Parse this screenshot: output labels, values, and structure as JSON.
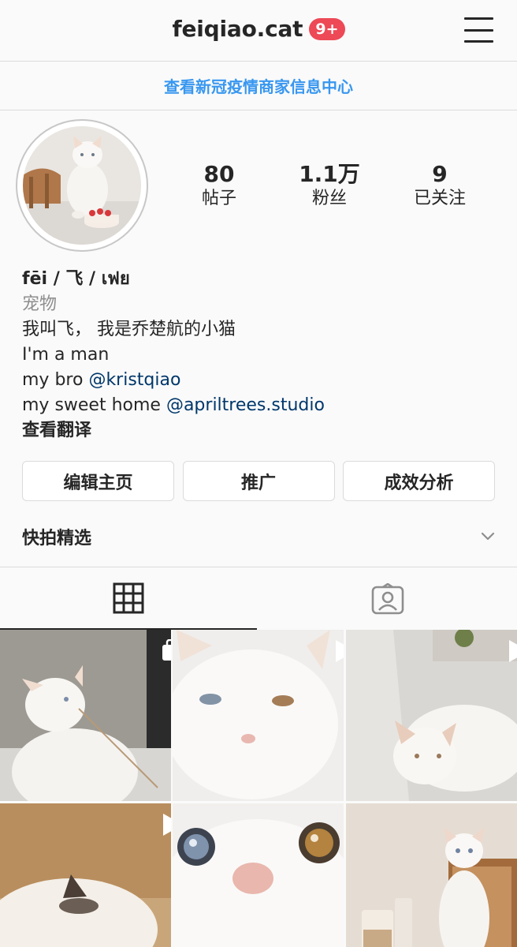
{
  "header": {
    "username": "feiqiao.cat",
    "notification_badge": "9+"
  },
  "banner": {
    "covid_link": "查看新冠疫情商家信息中心"
  },
  "profile": {
    "stats": [
      {
        "value": "80",
        "label": "帖子"
      },
      {
        "value": "1.1万",
        "label": "粉丝"
      },
      {
        "value": "9",
        "label": "已关注"
      }
    ],
    "bio": {
      "name": "fēi / 飞 / เฟย",
      "category": "宠物",
      "line1": "我叫飞， 我是乔楚航的小猫",
      "line2": "I'm a man",
      "line3_prefix": "my bro ",
      "line3_mention": "@kristqiao",
      "line4_prefix": "my sweet home ",
      "line4_mention": "@apriltrees.studio",
      "translate": "查看翻译"
    },
    "buttons": {
      "edit_profile": "编辑主页",
      "promote": "推广",
      "insights": "成效分析"
    },
    "highlights_label": "快拍精选"
  },
  "tabs": {
    "active": "grid",
    "icons": [
      "grid-icon",
      "tagged-icon"
    ]
  },
  "posts": [
    {
      "type": "multi",
      "badge": "carousel-icon"
    },
    {
      "type": "video",
      "badge": "play-icon"
    },
    {
      "type": "video",
      "badge": "play-icon"
    },
    {
      "type": "video",
      "badge": "play-icon"
    },
    {
      "type": "photo",
      "badge": ""
    },
    {
      "type": "photo",
      "badge": ""
    }
  ],
  "colors": {
    "link_blue": "#3897f0",
    "mention_blue": "#00376b",
    "badge_red": "#ed4956",
    "border": "#dbdbdb",
    "secondary_text": "#8e8e8e"
  }
}
